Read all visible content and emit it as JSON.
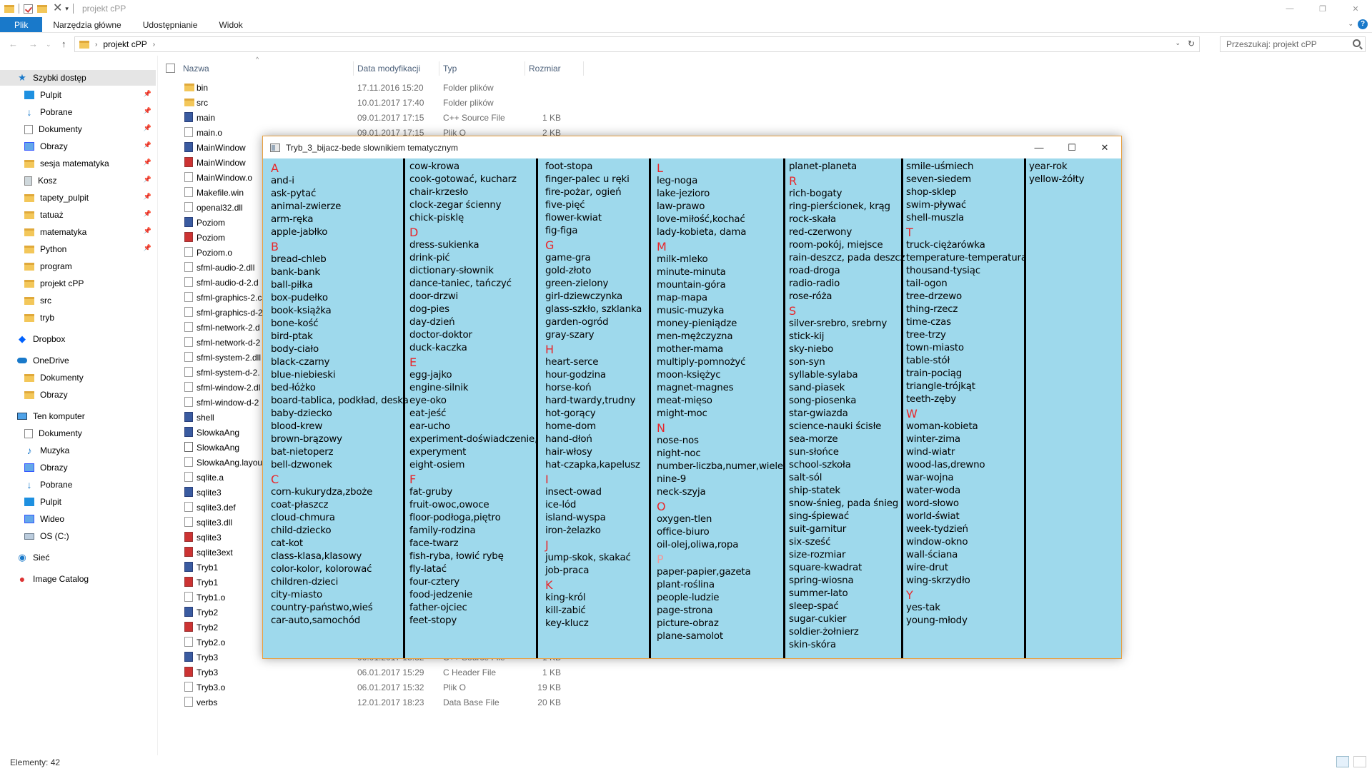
{
  "window": {
    "title": "projekt cPP",
    "controls": {
      "minimize": "—",
      "maximize": "❐",
      "close": "✕"
    }
  },
  "ribbon": {
    "tabs": [
      "Plik",
      "Narzędzia główne",
      "Udostępnianie",
      "Widok"
    ],
    "help": "?"
  },
  "address": {
    "crumb": "projekt cPP",
    "search_placeholder": "Przeszukaj: projekt cPP"
  },
  "nav": [
    {
      "label": "Szybki dostęp",
      "icon": "star-icon",
      "sel": true
    },
    {
      "label": "Pulpit",
      "icon": "desktop-icon",
      "pin": true
    },
    {
      "label": "Pobrane",
      "icon": "download-icon",
      "pin": true
    },
    {
      "label": "Dokumenty",
      "icon": "documents-icon",
      "pin": true
    },
    {
      "label": "Obrazy",
      "icon": "pictures-icon",
      "pin": true
    },
    {
      "label": "sesja matematyka",
      "icon": "folder-icon",
      "pin": true
    },
    {
      "label": "Kosz",
      "icon": "recycle-bin-icon",
      "pin": true
    },
    {
      "label": "tapety_pulpit",
      "icon": "folder-icon",
      "pin": true
    },
    {
      "label": "tatuaż",
      "icon": "folder-icon",
      "pin": true
    },
    {
      "label": "matematyka",
      "icon": "folder-icon",
      "pin": true
    },
    {
      "label": "Python",
      "icon": "folder-icon",
      "pin": true
    },
    {
      "label": "program",
      "icon": "folder-icon"
    },
    {
      "label": "projekt cPP",
      "icon": "folder-icon"
    },
    {
      "label": "src",
      "icon": "folder-icon"
    },
    {
      "label": "tryb",
      "icon": "folder-icon"
    },
    {
      "label": "Dropbox",
      "icon": "dropbox-icon"
    },
    {
      "label": "OneDrive",
      "icon": "onedrive-icon"
    },
    {
      "label": "Dokumenty",
      "icon": "folder-icon"
    },
    {
      "label": "Obrazy",
      "icon": "folder-icon"
    },
    {
      "label": "Ten komputer",
      "icon": "computer-icon"
    },
    {
      "label": "Dokumenty",
      "icon": "documents-icon"
    },
    {
      "label": "Muzyka",
      "icon": "music-icon"
    },
    {
      "label": "Obrazy",
      "icon": "pictures-icon"
    },
    {
      "label": "Pobrane",
      "icon": "download-icon"
    },
    {
      "label": "Pulpit",
      "icon": "desktop-icon"
    },
    {
      "label": "Wideo",
      "icon": "video-icon"
    },
    {
      "label": "OS (C:)",
      "icon": "drive-icon"
    },
    {
      "label": "Sieć",
      "icon": "network-icon"
    },
    {
      "label": "Image Catalog",
      "icon": "image-catalog-icon"
    }
  ],
  "columns": {
    "name": "Nazwa",
    "date": "Data modyfikacji",
    "type": "Typ",
    "size": "Rozmiar"
  },
  "files": [
    {
      "name": "bin",
      "date": "17.11.2016 15:20",
      "type": "Folder plików",
      "size": "",
      "icon": "folder"
    },
    {
      "name": "src",
      "date": "10.01.2017 17:40",
      "type": "Folder plików",
      "size": "",
      "icon": "folder"
    },
    {
      "name": "main",
      "date": "09.01.2017 17:15",
      "type": "C++ Source File",
      "size": "1 KB",
      "icon": "cpp"
    },
    {
      "name": "main.o",
      "date": "09.01.2017 17:15",
      "type": "Plik O",
      "size": "2 KB",
      "icon": "doc"
    },
    {
      "name": "MainWindow",
      "date": "",
      "type": "",
      "size": "",
      "icon": "cpp"
    },
    {
      "name": "MainWindow",
      "date": "",
      "type": "",
      "size": "",
      "icon": "red"
    },
    {
      "name": "MainWindow.o",
      "date": "",
      "type": "",
      "size": "",
      "icon": "doc"
    },
    {
      "name": "Makefile.win",
      "date": "",
      "type": "",
      "size": "",
      "icon": "doc"
    },
    {
      "name": "openal32.dll",
      "date": "",
      "type": "",
      "size": "",
      "icon": "doc"
    },
    {
      "name": "Poziom",
      "date": "",
      "type": "",
      "size": "",
      "icon": "cpp"
    },
    {
      "name": "Poziom",
      "date": "",
      "type": "",
      "size": "",
      "icon": "red"
    },
    {
      "name": "Poziom.o",
      "date": "",
      "type": "",
      "size": "",
      "icon": "doc"
    },
    {
      "name": "sfml-audio-2.dll",
      "date": "",
      "type": "",
      "size": "",
      "icon": "doc"
    },
    {
      "name": "sfml-audio-d-2.d",
      "date": "",
      "type": "",
      "size": "",
      "icon": "doc"
    },
    {
      "name": "sfml-graphics-2.c",
      "date": "",
      "type": "",
      "size": "",
      "icon": "doc"
    },
    {
      "name": "sfml-graphics-d-2",
      "date": "",
      "type": "",
      "size": "",
      "icon": "doc"
    },
    {
      "name": "sfml-network-2.d",
      "date": "",
      "type": "",
      "size": "",
      "icon": "doc"
    },
    {
      "name": "sfml-network-d-2",
      "date": "",
      "type": "",
      "size": "",
      "icon": "doc"
    },
    {
      "name": "sfml-system-2.dll",
      "date": "",
      "type": "",
      "size": "",
      "icon": "doc"
    },
    {
      "name": "sfml-system-d-2.",
      "date": "",
      "type": "",
      "size": "",
      "icon": "doc"
    },
    {
      "name": "sfml-window-2.dl",
      "date": "",
      "type": "",
      "size": "",
      "icon": "doc"
    },
    {
      "name": "sfml-window-d-2",
      "date": "",
      "type": "",
      "size": "",
      "icon": "doc"
    },
    {
      "name": "shell",
      "date": "",
      "type": "",
      "size": "",
      "icon": "cpp"
    },
    {
      "name": "SlowkaAng",
      "date": "",
      "type": "",
      "size": "",
      "icon": "cpp"
    },
    {
      "name": "SlowkaAng",
      "date": "",
      "type": "",
      "size": "",
      "icon": "exe"
    },
    {
      "name": "SlowkaAng.layout",
      "date": "",
      "type": "",
      "size": "",
      "icon": "doc"
    },
    {
      "name": "sqlite.a",
      "date": "",
      "type": "",
      "size": "",
      "icon": "doc"
    },
    {
      "name": "sqlite3",
      "date": "",
      "type": "",
      "size": "",
      "icon": "cpp"
    },
    {
      "name": "sqlite3.def",
      "date": "",
      "type": "",
      "size": "",
      "icon": "doc"
    },
    {
      "name": "sqlite3.dll",
      "date": "",
      "type": "",
      "size": "",
      "icon": "doc"
    },
    {
      "name": "sqlite3",
      "date": "",
      "type": "",
      "size": "",
      "icon": "red"
    },
    {
      "name": "sqlite3ext",
      "date": "",
      "type": "",
      "size": "",
      "icon": "red"
    },
    {
      "name": "Tryb1",
      "date": "",
      "type": "",
      "size": "",
      "icon": "cpp"
    },
    {
      "name": "Tryb1",
      "date": "",
      "type": "",
      "size": "",
      "icon": "red"
    },
    {
      "name": "Tryb1.o",
      "date": "",
      "type": "",
      "size": "",
      "icon": "doc"
    },
    {
      "name": "Tryb2",
      "date": "",
      "type": "",
      "size": "",
      "icon": "cpp"
    },
    {
      "name": "Tryb2",
      "date": "",
      "type": "",
      "size": "",
      "icon": "red"
    },
    {
      "name": "Tryb2.o",
      "date": "",
      "type": "",
      "size": "",
      "icon": "doc"
    },
    {
      "name": "Tryb3",
      "date": "06.01.2017 15:32",
      "type": "C++ Source File",
      "size": "1 KB",
      "icon": "cpp"
    },
    {
      "name": "Tryb3",
      "date": "06.01.2017 15:29",
      "type": "C Header File",
      "size": "1 KB",
      "icon": "red"
    },
    {
      "name": "Tryb3.o",
      "date": "06.01.2017 15:32",
      "type": "Plik O",
      "size": "19 KB",
      "icon": "doc"
    },
    {
      "name": "verbs",
      "date": "12.01.2017 18:23",
      "type": "Data Base File",
      "size": "20 KB",
      "icon": "doc"
    }
  ],
  "status": "Elementy: 42",
  "dict_window": {
    "title": "Tryb_3_bijacz-bede slownikiem tematycznym",
    "controls": {
      "minimize": "—",
      "maximize": "☐",
      "close": "✕"
    },
    "columns": [
      [
        "#A",
        "and-i",
        "ask-pytać",
        "animal-zwierze",
        "arm-ręka",
        "apple-jabłko",
        "#B",
        "bread-chleb",
        "bank-bank",
        "ball-piłka",
        "box-pudełko",
        "book-książka",
        "bone-kość",
        "bird-ptak",
        "body-ciało",
        "black-czarny",
        "blue-niebieski",
        "bed-łóżko",
        "board-tablica, podkład, deska",
        "baby-dziecko",
        "blood-krew",
        "brown-brązowy",
        "bat-nietoperz",
        "bell-dzwonek",
        "#C",
        "corn-kukurydza,zboże",
        "coat-płaszcz",
        "cloud-chmura",
        "child-dziecko",
        "cat-kot",
        "class-klasa,klasowy",
        "color-kolor, kolorować",
        "children-dzieci",
        "city-miasto",
        "country-państwo,wieś",
        "car-auto,samochód"
      ],
      [
        "cow-krowa",
        "cook-gotować, kucharz",
        "chair-krzesło",
        "clock-zegar ścienny",
        "chick-pisklę",
        "#D",
        "dress-sukienka",
        "drink-pić",
        "dictionary-słownik",
        "dance-taniec, tańczyć",
        "door-drzwi",
        "dog-pies",
        "day-dzień",
        "doctor-doktor",
        "duck-kaczka",
        "#E",
        "egg-jajko",
        "engine-silnik",
        "eye-oko",
        "eat-jeść",
        "ear-ucho",
        "experiment-doświadczenie,",
        "experyment",
        "eight-osiem",
        "#F",
        "fat-gruby",
        "fruit-owoc,owoce",
        "floor-podłoga,piętro",
        "family-rodzina",
        "face-twarz",
        "fish-ryba, łowić rybę",
        "fly-latać",
        "four-cztery",
        "food-jedzenie",
        "father-ojciec",
        "feet-stopy"
      ],
      [
        "foot-stopa",
        "finger-palec u ręki",
        "fire-pożar, ogień",
        "five-pięć",
        "flower-kwiat",
        "fig-figa",
        "#G",
        "game-gra",
        "gold-złoto",
        "green-zielony",
        "girl-dziewczynka",
        "glass-szkło, szklanka",
        "garden-ogród",
        "gray-szary",
        "#H",
        "heart-serce",
        "hour-godzina",
        "horse-koń",
        "hard-twardy,trudny",
        "hot-gorący",
        "home-dom",
        "hand-dłoń",
        "hair-włosy",
        "hat-czapka,kapelusz",
        "#I",
        "insect-owad",
        "ice-lód",
        "island-wyspa",
        "iron-żelazko",
        "#J",
        "jump-skok, skakać",
        "job-praca",
        "#K",
        "king-król",
        "kill-zabić",
        "key-klucz"
      ],
      [
        "#L",
        "leg-noga",
        "lake-jezioro",
        "law-prawo",
        "love-miłość,kochać",
        "lady-kobieta, dama",
        "#M",
        "milk-mleko",
        "minute-minuta",
        "mountain-góra",
        "map-mapa",
        "music-muzyka",
        "money-pieniądze",
        "men-mężczyzna",
        "mother-mama",
        "multiply-pomnożyć",
        "moon-księżyc",
        "magnet-magnes",
        "meat-mięso",
        "might-moc",
        "#N",
        "nose-nos",
        "night-noc",
        "number-liczba,numer,wiele",
        "nine-9",
        "neck-szyja",
        "#O",
        "oxygen-tlen",
        "office-biuro",
        "oil-olej,oliwa,ropa",
        "~P",
        "paper-papier,gazeta",
        "plant-roślina",
        "people-ludzie",
        "page-strona",
        "picture-obraz",
        "plane-samolot"
      ],
      [
        "planet-planeta",
        "#R",
        "rich-bogaty",
        "ring-pierścionek, krąg",
        "rock-skała",
        "red-czerwony",
        "room-pokój, miejsce",
        "rain-deszcz, pada deszcz",
        "road-droga",
        "radio-radio",
        "rose-róża",
        "#S",
        "silver-srebro, srebrny",
        "stick-kij",
        "sky-niebo",
        "son-syn",
        "syllable-sylaba",
        "sand-piasek",
        "song-piosenka",
        "star-gwiazda",
        "science-nauki ścisłe",
        "sea-morze",
        "sun-słońce",
        "school-szkoła",
        "salt-sól",
        "ship-statek",
        "snow-śnieg, pada śnieg",
        "sing-śpiewać",
        "suit-garnitur",
        "six-sześć",
        "size-rozmiar",
        "square-kwadrat",
        "spring-wiosna",
        "summer-lato",
        "sleep-spać",
        "sugar-cukier",
        "soldier-żołnierz",
        "skin-skóra"
      ],
      [
        "smile-uśmiech",
        "seven-siedem",
        "shop-sklep",
        "swim-pływać",
        "shell-muszla",
        "#T",
        "truck-ciężarówka",
        "temperature-temperatura",
        "thousand-tysiąc",
        "tail-ogon",
        "tree-drzewo",
        "thing-rzecz",
        "time-czas",
        "tree-trzy",
        "town-miasto",
        "table-stół",
        "train-pociąg",
        "triangle-trójkąt",
        "teeth-zęby",
        "#W",
        "woman-kobieta",
        "winter-zima",
        "wind-wiatr",
        "wood-las,drewno",
        "war-wojna",
        "water-woda",
        "word-słowo",
        "world-świat",
        "week-tydzień",
        "window-okno",
        "wall-ściana",
        "wire-drut",
        "wing-skrzydło",
        "#Y",
        "yes-tak",
        "young-młody"
      ],
      [
        "year-rok",
        "yellow-żółty"
      ]
    ]
  }
}
